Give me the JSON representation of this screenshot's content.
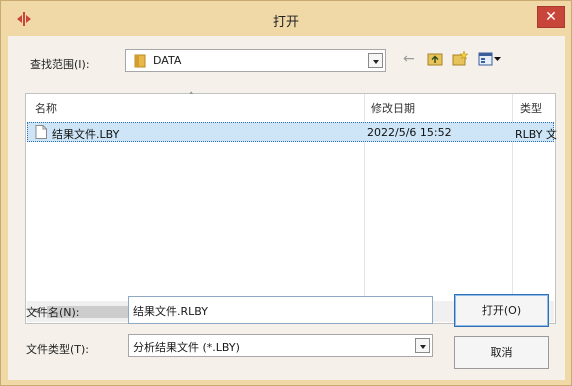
{
  "window": {
    "title": "打开",
    "close_glyph": "✕"
  },
  "lookin": {
    "label": "查找范围(I):",
    "value": "DATA"
  },
  "toolbar": {
    "back_glyph": "←"
  },
  "list": {
    "columns": [
      "名称",
      "修改日期",
      "类型"
    ],
    "rows": [
      {
        "name": "结果文件.LBY",
        "date": "2022/5/6 15:52",
        "type": "RLBY 文"
      }
    ],
    "scroll_left": "<",
    "scroll_right": ">"
  },
  "filename": {
    "label": "文件名(N):",
    "value": "结果文件.RLBY"
  },
  "filetype": {
    "label": "文件类型(T):",
    "value": "分析结果文件 (*.LBY)"
  },
  "buttons": {
    "open": "打开(O)",
    "cancel": "取消"
  },
  "colors": {
    "frame": "#f0d9a7",
    "close": "#c8453a",
    "selection": "#cde5f6"
  }
}
